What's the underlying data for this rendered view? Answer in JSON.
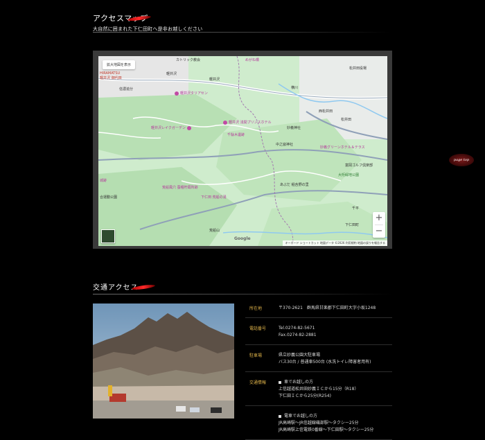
{
  "access_map": {
    "title": "アクセスマップ",
    "subtitle": "大自然に囲まれた下仁田町へ是非お越しください"
  },
  "map": {
    "larger_map_label": "拡大地図を表示",
    "zoom_in": "+",
    "zoom_out": "−",
    "google": "Google",
    "attribution": "キーボード ショートカット   地図データ ©2026   利用規約   地図の誤りを報告する",
    "labels": {
      "catholic": "カトリック教会",
      "megane": "めがね橋",
      "hiramatsu": "HIRAMATSU",
      "hiramatsu2": "軽井沢 御代田",
      "shinano": "信濃追分",
      "karuizawa": "軽井沢",
      "karuizawa_st": "軽井沢",
      "yokokawa": "横川",
      "matsuida_yaku": "松井田役場",
      "outlet": "軽井沢プリンス",
      "outlet2": "プリンスショッピングプラザ",
      "tama": "軽井沢タリアセン",
      "lake": "軽井沢レイクガーデン",
      "prince": "軽井沢 浅間プリンスホテル",
      "senda": "千駄木遺跡",
      "nishi_matsuida": "西松井田",
      "matsuida": "松井田",
      "myogi_shrine": "妙義神社",
      "nakanodake": "中之嶽神社",
      "myogi_green": "妙義グリーンホテル＆テラス",
      "tomioka_golf": "富岡ゴルフ倶楽部",
      "omura": "大桁緑地公園",
      "araragi": "あぶだ 稲含野の里",
      "arafune": "荒船風穴 蚕種貯蔵所跡",
      "shimonita_arafune": "下仁田 荒船の湯",
      "arafune_mt": "荒船山",
      "shimonita": "下仁田町",
      "jojo": "城跡",
      "undo": "合運動公園",
      "senbei": "千平",
      "r18": "18",
      "r254": "254"
    }
  },
  "page_top": "page top",
  "traffic": {
    "title": "交通アクセス",
    "rows": [
      {
        "label": "所在地",
        "lines": [
          "〒370-2621　群馬県甘楽郡下仁田町大字小坂1248"
        ]
      },
      {
        "label": "電話番号",
        "lines": [
          "Tel.0274-82-5671",
          "Fax.0274-82-2881"
        ]
      },
      {
        "label": "駐車場",
        "lines": [
          "県立妙義公園大駐車場",
          "バス30台 / 普通車500台 (水洗トイレ障害者用有)"
        ]
      },
      {
        "label": "交通情報",
        "lines": [
          "車でお越しの方",
          "上信越道松井田妙義ＩＣから15分（R18）",
          "下仁田ＩＣから25分(R254)"
        ]
      },
      {
        "label": "",
        "lines": [
          "電車でお越しの方",
          "JR高崎駅～JR信越線磯部駅～タクシー25分",
          "JR高崎駅上信電鉄0番線～下仁田駅～タクシー25分"
        ]
      }
    ]
  }
}
